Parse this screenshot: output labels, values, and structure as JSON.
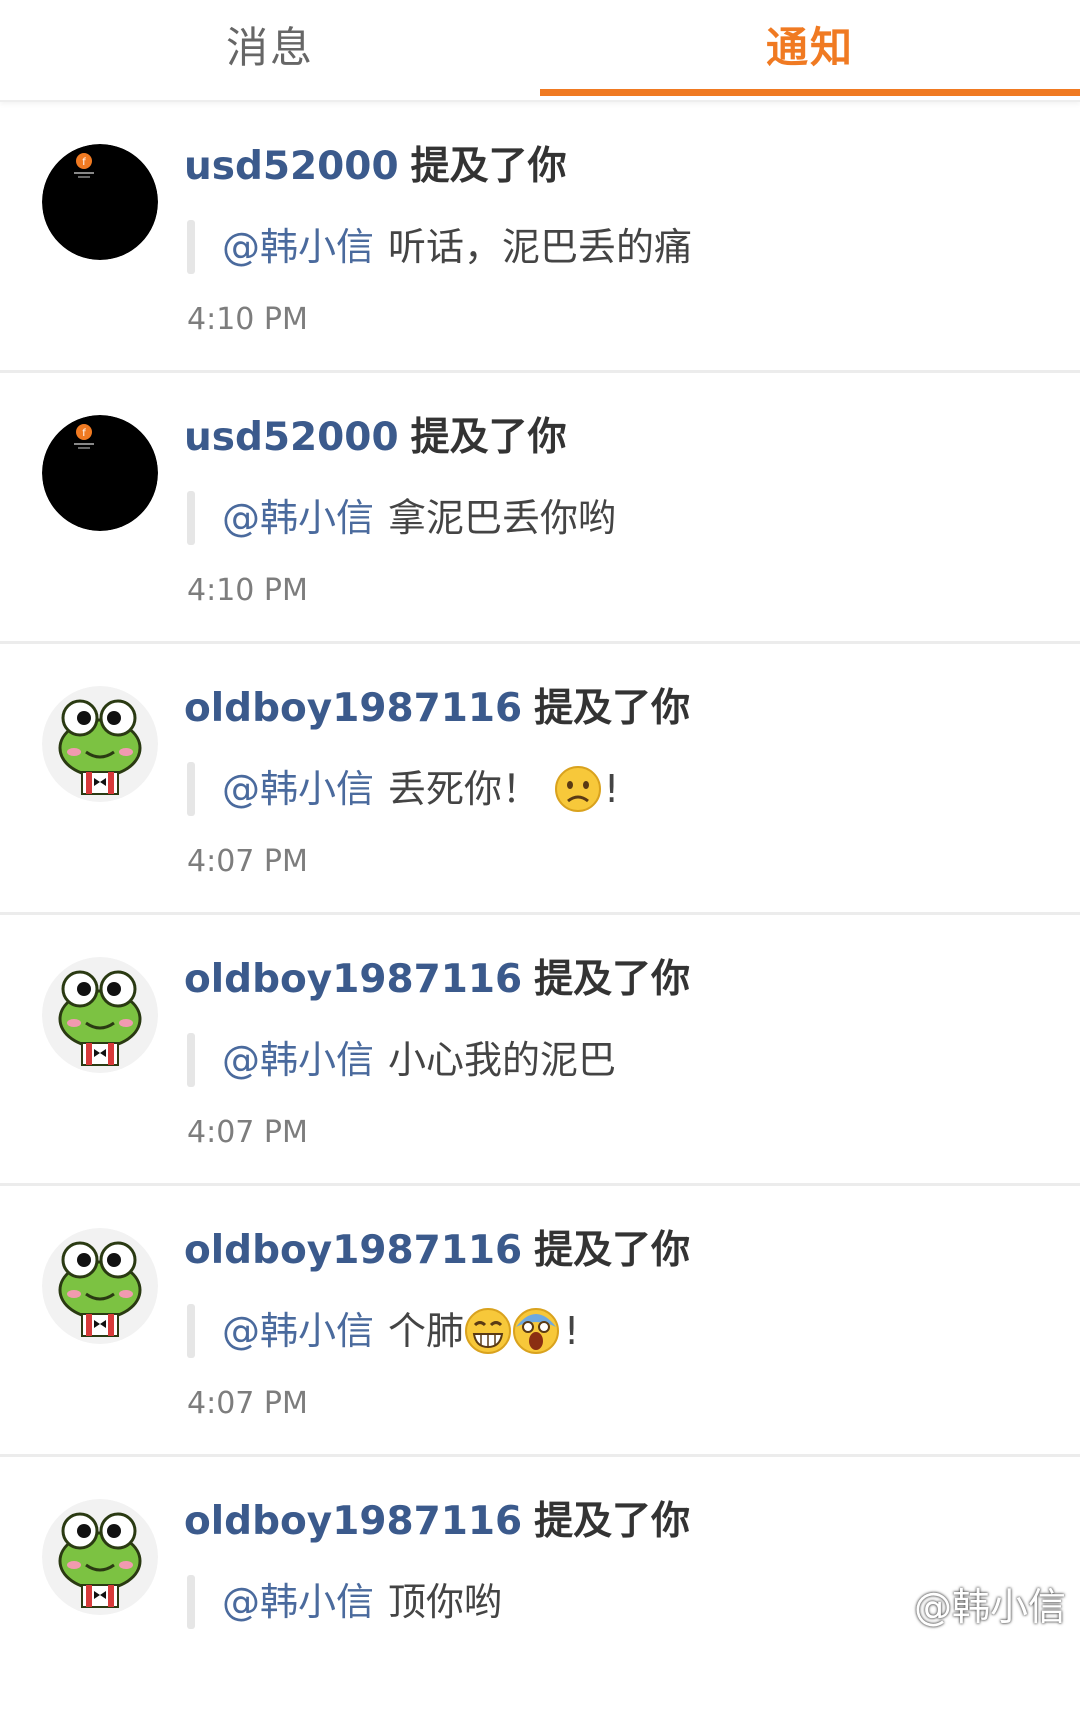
{
  "tabs": {
    "messages_label": "消息",
    "notifications_label": "通知",
    "active": "notifications",
    "accent_color": "#f07a22"
  },
  "notifications": [
    {
      "avatar": "black-circle-logo",
      "username": "usd52000",
      "action": "提及了你",
      "mention": "@韩小信",
      "text": "听话，泥巴丢的痛",
      "emoji_tail": "",
      "time": "4:10 PM"
    },
    {
      "avatar": "black-circle-logo",
      "username": "usd52000",
      "action": "提及了你",
      "mention": "@韩小信",
      "text": "拿泥巴丢你哟",
      "emoji_tail": "",
      "time": "4:10 PM"
    },
    {
      "avatar": "green-frog",
      "username": "oldboy1987116",
      "action": "提及了你",
      "mention": "@韩小信",
      "text": "丢死你！",
      "emoji_tail": "!",
      "time": "4:07 PM"
    },
    {
      "avatar": "green-frog",
      "username": "oldboy1987116",
      "action": "提及了你",
      "mention": "@韩小信",
      "text": "小心我的泥巴",
      "emoji_tail": "",
      "time": "4:07 PM"
    },
    {
      "avatar": "green-frog",
      "username": "oldboy1987116",
      "action": "提及了你",
      "mention": "@韩小信",
      "text": "个肺",
      "emoji_tail": "!",
      "time": "4:07 PM"
    },
    {
      "avatar": "green-frog",
      "username": "oldboy1987116",
      "action": "提及了你",
      "mention": "@韩小信",
      "text": "顶你哟",
      "emoji_tail": "",
      "time": ""
    }
  ],
  "watermark": "@韩小信"
}
